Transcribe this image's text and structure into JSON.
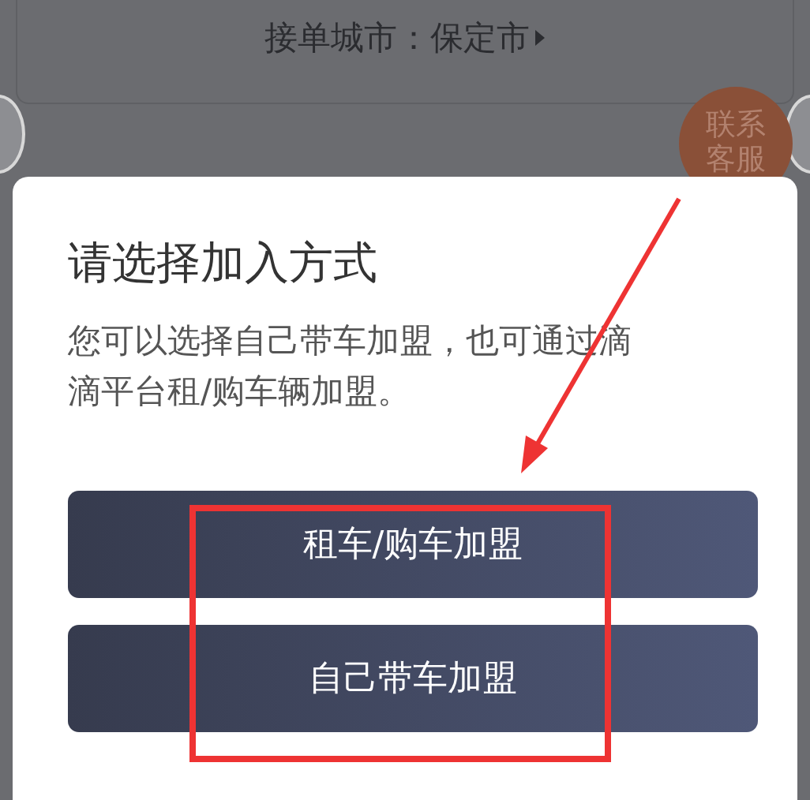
{
  "header": {
    "city_label": "接单城市：保定市"
  },
  "contact_button": {
    "label": "联系客服"
  },
  "sheet": {
    "title": "请选择加入方式",
    "description": "您可以选择自己带车加盟，也可通过滴滴平台租/购车辆加盟。",
    "options": [
      {
        "label": "租车/购车加盟"
      },
      {
        "label": "自己带车加盟"
      }
    ]
  }
}
